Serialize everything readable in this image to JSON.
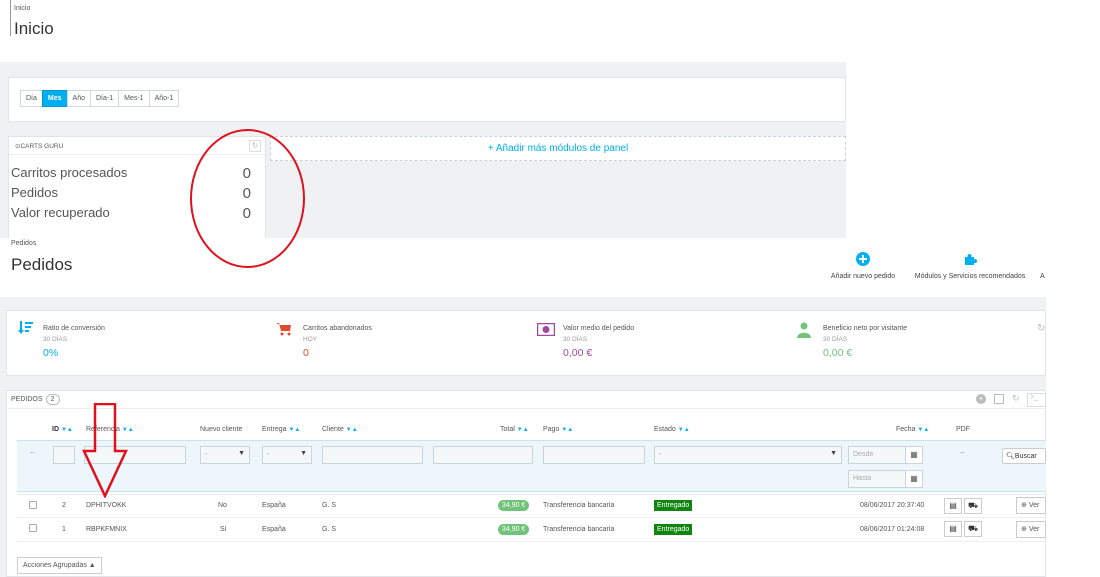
{
  "inicio": {
    "breadcrumb": "Inicio",
    "title": "Inicio",
    "periods": [
      "Día",
      "Mes",
      "Año",
      "Día-1",
      "Mes-1",
      "Año-1"
    ],
    "active_period": "Mes",
    "carts_guru": {
      "header": "CARTS GURU",
      "rows": [
        {
          "label": "Carritos procesados",
          "value": "0"
        },
        {
          "label": "Pedidos",
          "value": "0"
        },
        {
          "label": "Valor recuperado",
          "value": "0"
        }
      ]
    },
    "add_modules": "+ Añadir más módulos de panel"
  },
  "pedidos": {
    "breadcrumb": "Pedidos",
    "title": "Pedidos",
    "toolbar": {
      "add_order": "Añadir nuevo pedido",
      "modules": "Módulos y Servicios recomendados",
      "third_partial": "A"
    },
    "kpis": [
      {
        "label": "Ratio de conversión",
        "sub": "30 DÍAS",
        "value": "0%",
        "color": "#00aff0",
        "icon": "sort-amount-icon"
      },
      {
        "label": "Carritos abandonados",
        "sub": "HOY",
        "value": "0",
        "color": "#e3492d",
        "icon": "shopping-cart-icon"
      },
      {
        "label": "Valor medio del pedido",
        "sub": "30 DÍAS",
        "value": "0,00 €",
        "color": "#a2489f",
        "icon": "money-icon"
      },
      {
        "label": "Beneficio neto por visitante",
        "sub": "30 DÍAS",
        "value": "0,00 €",
        "color": "#72c279",
        "icon": "user-icon"
      }
    ],
    "list": {
      "header": "PEDIDOS",
      "count": "2",
      "columns": [
        "ID",
        "Referencia",
        "Nuevo cliente",
        "Entrega",
        "Cliente",
        "Total",
        "Pago",
        "Estado",
        "Fecha",
        "PDF"
      ],
      "filter": {
        "dash": "--",
        "select_dash": "-",
        "desde": "Desde",
        "hasta": "Hasta",
        "buscar": "Buscar"
      },
      "rows": [
        {
          "id": "2",
          "ref": "DPHITVOKK",
          "nuevo": "No",
          "entrega": "España",
          "cliente": "G. S",
          "total": "34,90 €",
          "pago": "Transferencia bancaria",
          "estado": "Entregado",
          "fecha": "08/06/2017 20:37:40",
          "ver": "Ver"
        },
        {
          "id": "1",
          "ref": "RBPKFMNIX",
          "nuevo": "Sí",
          "entrega": "España",
          "cliente": "G. S",
          "total": "34,90 €",
          "pago": "Transferencia bancaria",
          "estado": "Entregado",
          "fecha": "08/06/2017 01:24:08",
          "ver": "Ver"
        }
      ],
      "bulk_actions": "Acciones Agrupadas ▲"
    }
  },
  "colors": {
    "accent": "#00aff0",
    "annotation_red": "#e0111f",
    "entregado": "#108510",
    "total_green": "#72c279"
  }
}
